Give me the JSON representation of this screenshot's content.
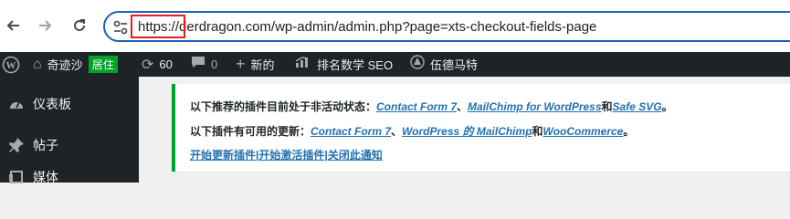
{
  "browser": {
    "url_scheme": "https://",
    "url_rest": "derdragon.com/wp-admin/admin.php?page=xts-checkout-fields-page"
  },
  "admin_bar": {
    "site_name": "奇迹沙",
    "live_badge": "居住",
    "updates_count": "60",
    "comments_count": "0",
    "new_label": "新的",
    "seo_label": "排名数学 SEO",
    "wordfence_label": "伍德马特"
  },
  "menu": {
    "items": [
      {
        "label": "仪表板",
        "icon": "dashboard-icon"
      },
      {
        "label": "帖子",
        "icon": "pin-icon"
      },
      {
        "label": "媒体",
        "icon": "media-icon"
      }
    ]
  },
  "notice": {
    "line1_prefix": "以下推荐的插件目前处于非活动状态：",
    "line1_link1": "Contact Form 7",
    "line1_sep1": "、",
    "line1_link2": "MailChimp for WordPress",
    "line1_and": "和",
    "line1_link3": "Safe SVG",
    "line1_end": "。",
    "line2_prefix": "以下插件有可用的更新：",
    "line2_link1": "Contact Form 7",
    "line2_sep1": "、",
    "line2_link2": "WordPress 的 MailChimp",
    "line2_and": "和",
    "line2_link3": "WooCommerce",
    "line2_end": "。",
    "action1": "开始更新插件",
    "action_sep1": "|",
    "action2": "开始激活插件",
    "action_sep2": "|",
    "action3": "关闭此通知"
  },
  "colors": {
    "admin_bar_bg": "#1d2327",
    "notice_border": "#00a32a",
    "link": "#2271b1",
    "highlight_box": "#e02020"
  }
}
